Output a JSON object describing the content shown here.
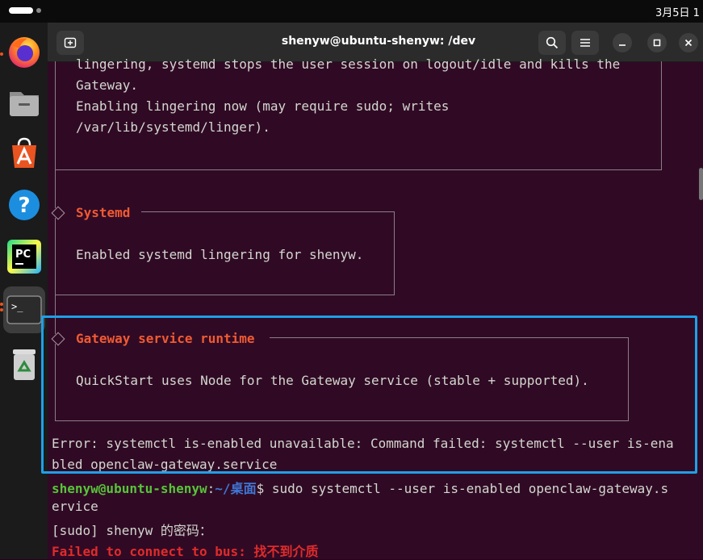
{
  "topbar": {
    "clock": "3月5日 1"
  },
  "dock": {
    "apps": [
      {
        "name": "Firefox",
        "icon": "firefox-icon"
      },
      {
        "name": "Files",
        "icon": "files-icon"
      },
      {
        "name": "App Center",
        "icon": "app-center-icon"
      },
      {
        "name": "Help",
        "icon": "help-icon"
      },
      {
        "name": "PyCharm",
        "icon": "pycharm-icon",
        "glyph": "PC"
      },
      {
        "name": "Terminal",
        "icon": "terminal-icon",
        "glyph": ">_"
      },
      {
        "name": "Trash",
        "icon": "trash-icon"
      }
    ]
  },
  "window": {
    "title": "shenyw@ubuntu-shenyw: /dev"
  },
  "terminal": {
    "top_box_lines": [
      "lingering, systemd stops the user session on logout/idle and kills the",
      "Gateway.",
      "Enabling lingering now (may require sudo; writes",
      "/var/lib/systemd/linger)."
    ],
    "systemd_section": {
      "title": "Systemd",
      "body": "Enabled systemd lingering for shenyw."
    },
    "gateway_section": {
      "title": "Gateway service runtime",
      "body": "QuickStart uses Node for the Gateway service (stable + supported)."
    },
    "error_lines": [
      "Error: systemctl is-enabled unavailable: Command failed: systemctl --user is-ena",
      "bled openclaw-gateway.service"
    ],
    "prompt": {
      "user_host": "shenyw@ubuntu-shenyw",
      "colon": ":",
      "path": "~/桌面",
      "dollar": "$ ",
      "command_line1": "sudo systemctl --user is-enabled openclaw-gateway.s",
      "command_line2": "ervice"
    },
    "sudo_prompt": "[sudo] shenyw 的密码：",
    "failure": "Failed to connect to bus: 找不到介质"
  },
  "colors": {
    "terminal_bg": "#300a24",
    "accent_orange": "#f05a33",
    "highlight_blue": "#1ea0e8",
    "prompt_green": "#57c43a",
    "prompt_blue": "#3f77d6",
    "error_red": "#e02b2b"
  }
}
